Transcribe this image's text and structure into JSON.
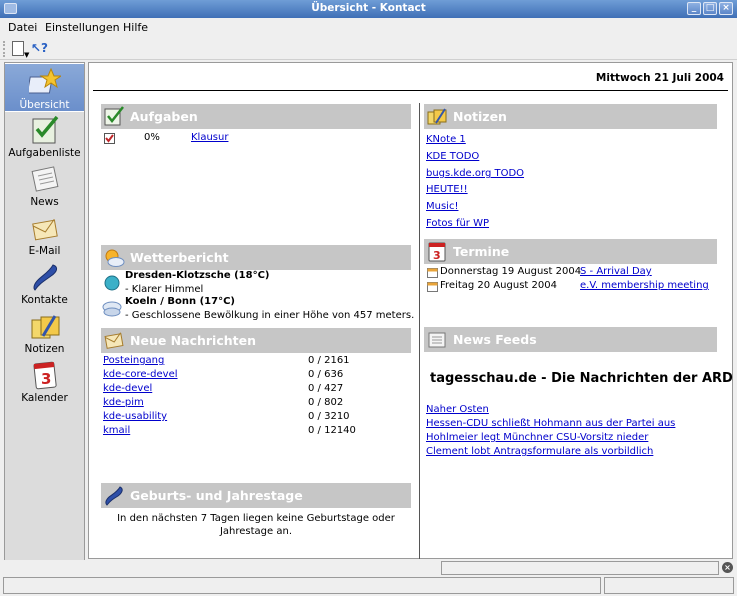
{
  "window": {
    "title": "Übersicht - Kontact"
  },
  "menubar": {
    "items": [
      "Datei",
      "Einstellungen",
      "Hilfe"
    ]
  },
  "sidebar": {
    "items": [
      {
        "label": "Übersicht",
        "icon": "summary-icon",
        "active": true
      },
      {
        "label": "Aufgabenliste",
        "icon": "todo-icon"
      },
      {
        "label": "News",
        "icon": "news-icon"
      },
      {
        "label": "E-Mail",
        "icon": "mail-icon"
      },
      {
        "label": "Kontakte",
        "icon": "contacts-icon"
      },
      {
        "label": "Notizen",
        "icon": "notes-icon"
      },
      {
        "label": "Kalender",
        "icon": "calendar-icon"
      }
    ]
  },
  "summary": {
    "date": "Mittwoch 21 Juli 2004",
    "tasks": {
      "title": "Aufgaben",
      "items": [
        {
          "percent": "0%",
          "name": "Klausur"
        }
      ]
    },
    "weather": {
      "title": "Wetterbericht",
      "stations": [
        {
          "name": "Dresden-Klotzsche (18°C)",
          "desc": "- Klarer Himmel"
        },
        {
          "name": "Koeln / Bonn (17°C)",
          "desc": "- Geschlossene Bewölkung in einer Höhe von 457 meters."
        }
      ]
    },
    "mail": {
      "title": "Neue Nachrichten",
      "folders": [
        {
          "name": "Posteingang",
          "count": "0 / 2161"
        },
        {
          "name": "kde-core-devel",
          "count": "0 / 636"
        },
        {
          "name": "kde-devel",
          "count": "0 / 427"
        },
        {
          "name": "kde-pim",
          "count": "0 / 802"
        },
        {
          "name": "kde-usability",
          "count": "0 / 3210"
        },
        {
          "name": "kmail",
          "count": "0 / 12140"
        }
      ]
    },
    "birthdays": {
      "title": "Geburts- und Jahrestage",
      "text_line1": "In den nächsten 7 Tagen liegen keine Geburtstage oder",
      "text_line2": "Jahrestage an."
    },
    "notes": {
      "title": "Notizen",
      "items": [
        "KNote 1",
        "KDE TODO",
        "bugs.kde.org TODO",
        "HEUTE!!",
        "Music!",
        "Fotos für WP"
      ]
    },
    "appointments": {
      "title": "Termine",
      "items": [
        {
          "date": "Donnerstag 19 August 2004",
          "summary": "S - Arrival Day"
        },
        {
          "date": "Freitag 20 August 2004",
          "summary": "e.V. membership meeting"
        }
      ]
    },
    "newsfeeds": {
      "title": "News Feeds",
      "feed_title": "tagesschau.de - Die Nachrichten der ARD",
      "items": [
        "Naher Osten",
        "Hessen-CDU schließt Hohmann aus der Partei aus",
        "Hohlmeier legt Münchner CSU-Vorsitz nieder",
        "Clement lobt Antragsformulare als vorbildlich"
      ]
    }
  },
  "colors": {
    "titlebar": "#4f7fc4",
    "section_header": "#c6c6c6",
    "link": "#0000cc",
    "sidebar_active": "#7b9bd0"
  }
}
